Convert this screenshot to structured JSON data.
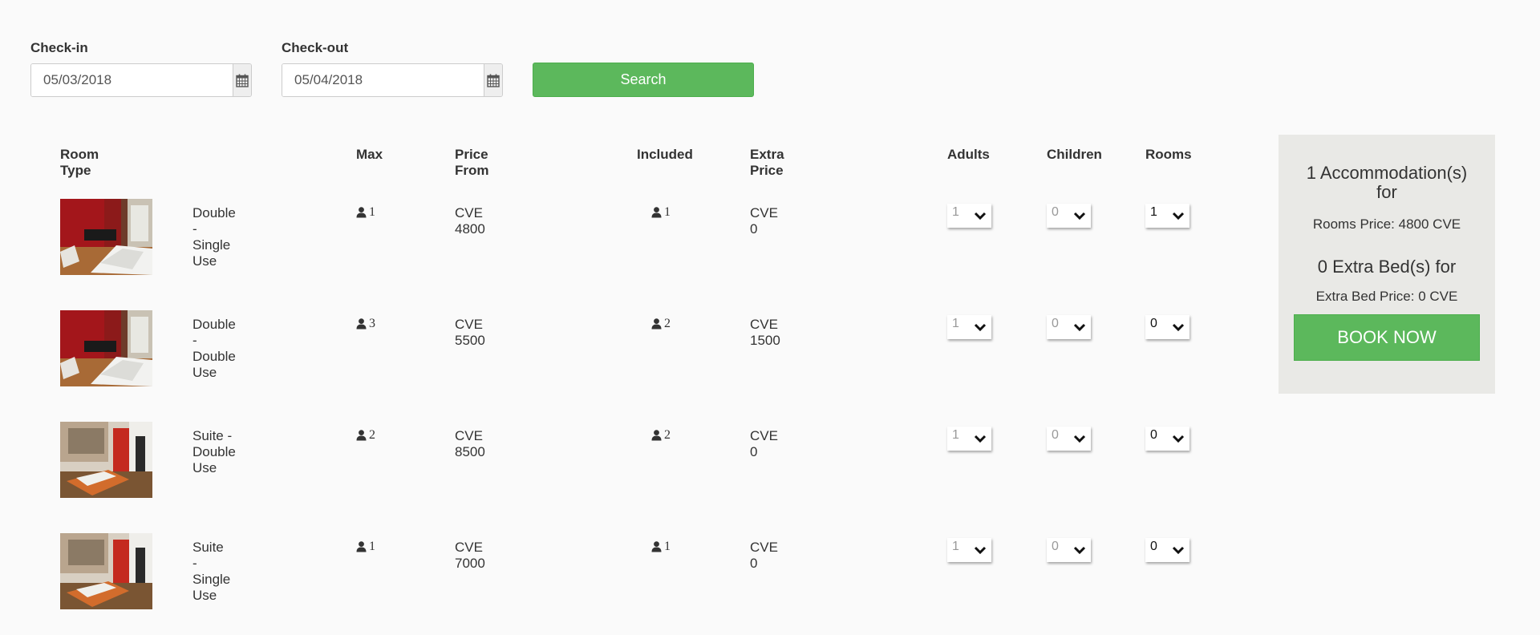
{
  "search": {
    "checkin_label": "Check-in",
    "checkin_value": "05/03/2018",
    "checkout_label": "Check-out",
    "checkout_value": "05/04/2018",
    "search_label": "Search",
    "icon": "calendar-icon"
  },
  "table": {
    "headers": {
      "room_type": "Room Type",
      "max": "Max",
      "price_from": "Price From",
      "included": "Included",
      "extra_price": "Extra Price",
      "adults": "Adults",
      "children": "Children",
      "rooms": "Rooms"
    },
    "rows": [
      {
        "name": "Double - Single Use",
        "max": "1",
        "price": "CVE 4800",
        "included": "1",
        "extra": "CVE 0",
        "adults": "1",
        "children": "0",
        "rooms": "1",
        "photo": "red-room"
      },
      {
        "name": "Double - Double Use",
        "max": "3",
        "price": "CVE 5500",
        "included": "2",
        "extra": "CVE 1500",
        "adults": "1",
        "children": "0",
        "rooms": "0",
        "photo": "red-room"
      },
      {
        "name": "Suite - Double Use",
        "max": "2",
        "price": "CVE 8500",
        "included": "2",
        "extra": "CVE 0",
        "adults": "1",
        "children": "0",
        "rooms": "0",
        "photo": "suite-room"
      },
      {
        "name": "Suite - Single Use",
        "max": "1",
        "price": "CVE 7000",
        "included": "1",
        "extra": "CVE 0",
        "adults": "1",
        "children": "0",
        "rooms": "0",
        "photo": "suite-room"
      }
    ]
  },
  "booking": {
    "accommodations_line1": "1 Accommodation(s)",
    "accommodations_line2": "for",
    "rooms_price": "Rooms Price: 4800 CVE",
    "extra_beds": "0 Extra Bed(s) for",
    "extra_bed_price": "Extra Bed Price: 0 CVE",
    "book_label": "BOOK NOW"
  },
  "colors": {
    "accent": "#5cb85c",
    "panel": "#e9e9e6",
    "background": "#fafafa"
  }
}
